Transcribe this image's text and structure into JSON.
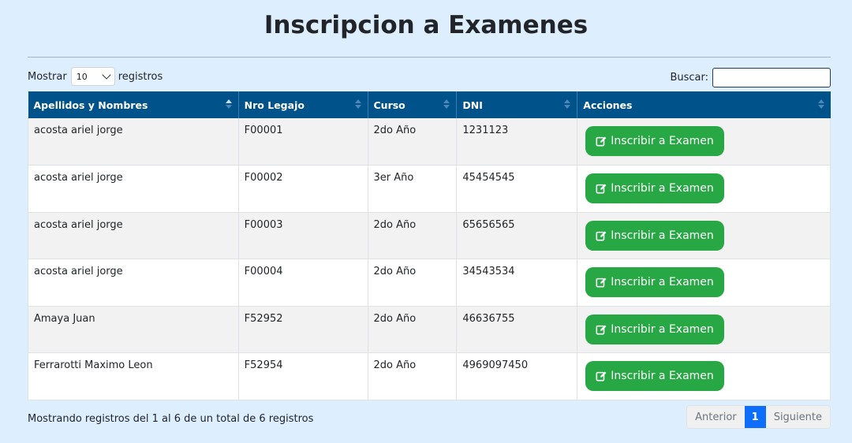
{
  "page": {
    "title": "Inscripcion a Examenes"
  },
  "length_control": {
    "prefix": "Mostrar",
    "value": "10",
    "suffix": "registros"
  },
  "search": {
    "label": "Buscar:",
    "value": ""
  },
  "table": {
    "columns": [
      "Apellidos y Nombres",
      "Nro Legajo",
      "Curso",
      "DNI",
      "Acciones"
    ],
    "action_label": "Inscribir a Examen",
    "rows": [
      {
        "nombre": "acosta ariel jorge",
        "legajo": "F00001",
        "curso": "2do Año",
        "dni": "1231123"
      },
      {
        "nombre": "acosta ariel jorge",
        "legajo": "F00002",
        "curso": "3er Año",
        "dni": "45454545"
      },
      {
        "nombre": "acosta ariel jorge",
        "legajo": "F00003",
        "curso": "2do Año",
        "dni": "65656565"
      },
      {
        "nombre": "acosta ariel jorge",
        "legajo": "F00004",
        "curso": "2do Año",
        "dni": "34543534"
      },
      {
        "nombre": "Amaya Juan",
        "legajo": "F52952",
        "curso": "2do Año",
        "dni": "46636755"
      },
      {
        "nombre": "Ferrarotti Maximo Leon",
        "legajo": "F52954",
        "curso": "2do Año",
        "dni": "4969097450"
      }
    ]
  },
  "footer": {
    "info": "Mostrando registros del 1 al 6 de un total de 6 registros",
    "prev": "Anterior",
    "current_page": "1",
    "next": "Siguiente"
  },
  "colors": {
    "header": "#00528a",
    "action": "#28a745",
    "page_active": "#0d6efd",
    "background": "#ddeefe"
  },
  "icons": {
    "action_icon": "edit-icon"
  }
}
